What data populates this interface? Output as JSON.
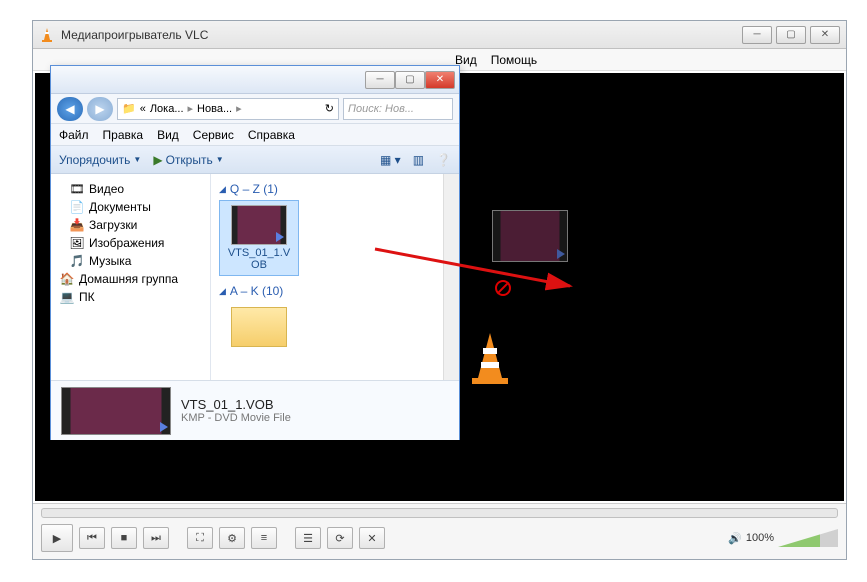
{
  "vlc": {
    "title": "Медиапроигрыватель VLC",
    "menu": [
      "Вид",
      "Помощь"
    ],
    "volume_label": "100%"
  },
  "explorer": {
    "breadcrumb": {
      "prefix": "«",
      "p1": "Лока...",
      "p2": "Нова...",
      "sep": "▸"
    },
    "search_placeholder": "Поиск: Нов...",
    "menu": [
      "Файл",
      "Правка",
      "Вид",
      "Сервис",
      "Справка"
    ],
    "toolbar": {
      "organize": "Упорядочить",
      "open": "Открыть"
    },
    "tree": [
      {
        "icon": "🎞",
        "label": "Видео"
      },
      {
        "icon": "📄",
        "label": "Документы"
      },
      {
        "icon": "📥",
        "label": "Загрузки"
      },
      {
        "icon": "🖼",
        "label": "Изображения"
      },
      {
        "icon": "🎵",
        "label": "Музыка"
      },
      {
        "icon": "🏠",
        "label": "Домашняя группа"
      },
      {
        "icon": "💻",
        "label": "ПК"
      }
    ],
    "groups": [
      {
        "title": "Q – Z (1)",
        "files": [
          {
            "name": "VTS_01_1.VOB",
            "type": "video",
            "selected": true
          }
        ]
      },
      {
        "title": "A – K (10)",
        "files": [
          {
            "name": "",
            "type": "folder",
            "selected": false
          }
        ]
      }
    ],
    "details": {
      "name": "VTS_01_1.VOB",
      "type": "KMP - DVD Movie File"
    }
  }
}
